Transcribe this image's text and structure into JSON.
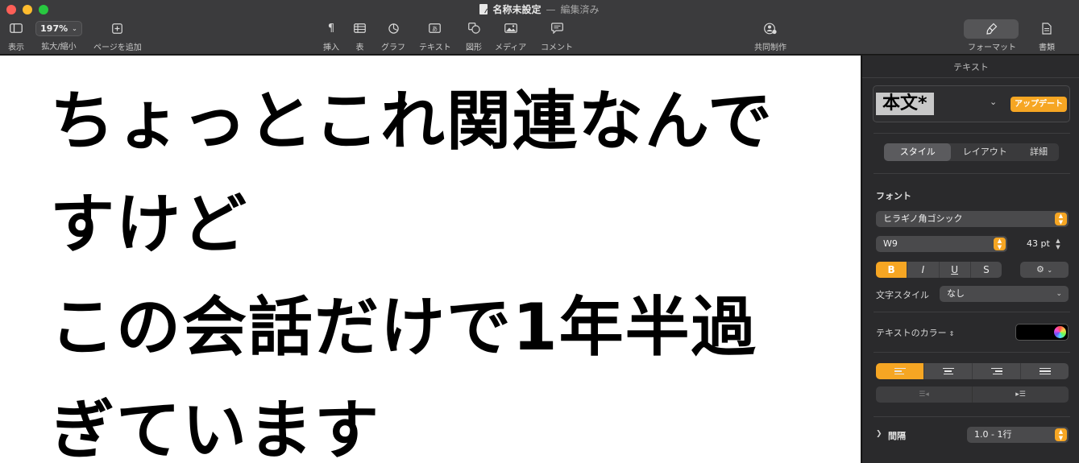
{
  "window": {
    "title": "名称未設定",
    "separator": "—",
    "status": "編集済み"
  },
  "toolbar": {
    "view_label": "表示",
    "zoom_value": "197%",
    "zoom_label": "拡大/縮小",
    "add_page_label": "ページを追加",
    "insert_label": "挿入",
    "table_label": "表",
    "chart_label": "グラフ",
    "text_label": "テキスト",
    "shape_label": "図形",
    "media_label": "メディア",
    "comment_label": "コメント",
    "collaborate_label": "共同制作",
    "format_label": "フォーマット",
    "document_label": "書類"
  },
  "document": {
    "lines": [
      "ちょっとこれ関連なんで",
      "すけど",
      "この会話だけで1年半過",
      "ぎています"
    ]
  },
  "inspector": {
    "title": "テキスト",
    "paragraph_style": "本文*",
    "update_button": "アップデート",
    "tabs": [
      {
        "label": "スタイル",
        "active": true
      },
      {
        "label": "レイアウト",
        "active": false
      },
      {
        "label": "詳細",
        "active": false
      }
    ],
    "font_section": "フォント",
    "font_family": "ヒラギノ角ゴシック",
    "font_weight": "W9",
    "font_size": "43 pt",
    "bius": {
      "bold": "B",
      "italic": "I",
      "underline": "U",
      "strike": "S"
    },
    "char_style_label": "文字スタイル",
    "char_style_value": "なし",
    "text_color_label": "テキストのカラー",
    "text_color": "#000000",
    "spacing_label": "間隔",
    "spacing_value": "1.0 - 1行"
  },
  "colors": {
    "accent": "#f6a623",
    "toolbar": "#3b3b3d",
    "inspector": "#2a2a2c"
  }
}
